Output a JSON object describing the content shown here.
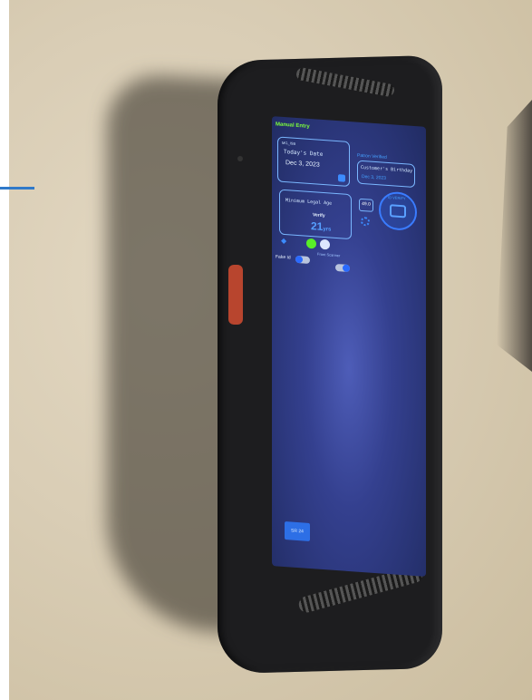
{
  "app": {
    "title": "Manual Entry",
    "top_small": "MG_ISB",
    "todays_date_label": "Today's Date",
    "todays_date_value": "Dec 3, 2023",
    "min_age_label": "Minimum Legal Age",
    "verify_label": "Verify",
    "age_value": "21",
    "age_unit": "yrs",
    "bday_header": "Patron Verified",
    "bday_label": "Customer's Birthday",
    "bday_value": "Dec 3, 2023",
    "box_value": "49.0",
    "seal_text": "ID VERIFY",
    "fake_id_label": "Fake Id",
    "front_scanner_label": "Front Scanner",
    "bottom_button": "SR 24"
  },
  "colors": {
    "accent_green": "#7dff3c",
    "accent_blue": "#3c8cff",
    "screen_bg": "#2a3577",
    "device_body": "#1d1d1f",
    "side_button": "#b8452e"
  },
  "icons": [
    "calendar-icon",
    "binoculars-icon",
    "gear-icon",
    "id-card-seal-icon"
  ]
}
